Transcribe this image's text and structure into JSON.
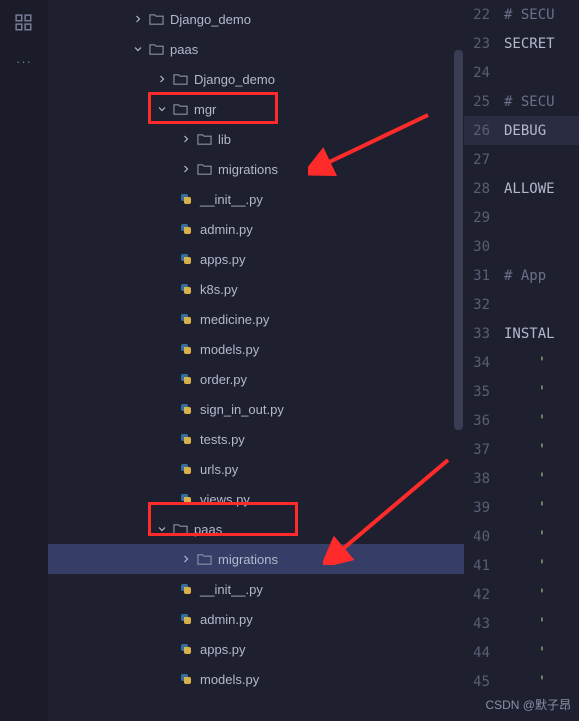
{
  "tree": [
    {
      "depth": 3,
      "type": "folder",
      "state": "collapsed",
      "label": "Django_demo"
    },
    {
      "depth": 3,
      "type": "folder",
      "state": "expanded",
      "label": "paas"
    },
    {
      "depth": 4,
      "type": "folder",
      "state": "collapsed",
      "label": "Django_demo"
    },
    {
      "depth": 4,
      "type": "folder",
      "state": "expanded",
      "label": "mgr"
    },
    {
      "depth": 5,
      "type": "folder",
      "state": "collapsed",
      "label": "lib"
    },
    {
      "depth": 5,
      "type": "folder",
      "state": "collapsed",
      "label": "migrations"
    },
    {
      "depth": 5,
      "type": "py",
      "label": "__init__.py"
    },
    {
      "depth": 5,
      "type": "py",
      "label": "admin.py"
    },
    {
      "depth": 5,
      "type": "py",
      "label": "apps.py"
    },
    {
      "depth": 5,
      "type": "py",
      "label": "k8s.py"
    },
    {
      "depth": 5,
      "type": "py",
      "label": "medicine.py"
    },
    {
      "depth": 5,
      "type": "py",
      "label": "models.py"
    },
    {
      "depth": 5,
      "type": "py",
      "label": "order.py"
    },
    {
      "depth": 5,
      "type": "py",
      "label": "sign_in_out.py"
    },
    {
      "depth": 5,
      "type": "py",
      "label": "tests.py"
    },
    {
      "depth": 5,
      "type": "py",
      "label": "urls.py"
    },
    {
      "depth": 5,
      "type": "py",
      "label": "views.py"
    },
    {
      "depth": 4,
      "type": "folder",
      "state": "expanded",
      "label": "paas"
    },
    {
      "depth": 5,
      "type": "folder",
      "state": "collapsed",
      "label": "migrations",
      "selected": true
    },
    {
      "depth": 5,
      "type": "py",
      "label": "__init__.py"
    },
    {
      "depth": 5,
      "type": "py",
      "label": "admin.py"
    },
    {
      "depth": 5,
      "type": "py",
      "label": "apps.py"
    },
    {
      "depth": 5,
      "type": "py",
      "label": "models.py"
    }
  ],
  "editor": [
    {
      "n": 22,
      "text": "# SECU",
      "cls": "comment"
    },
    {
      "n": 23,
      "text": "SECRET",
      "cls": "kw"
    },
    {
      "n": 24,
      "text": "",
      "cls": ""
    },
    {
      "n": 25,
      "text": "# SECU",
      "cls": "comment"
    },
    {
      "n": 26,
      "text": "DEBUG ",
      "cls": "kw",
      "current": true
    },
    {
      "n": 27,
      "text": "",
      "cls": ""
    },
    {
      "n": 28,
      "text": "ALLOWE",
      "cls": "kw"
    },
    {
      "n": 29,
      "text": "",
      "cls": ""
    },
    {
      "n": 30,
      "text": "",
      "cls": ""
    },
    {
      "n": 31,
      "text": "# App",
      "cls": "comment"
    },
    {
      "n": 32,
      "text": "",
      "cls": ""
    },
    {
      "n": 33,
      "text": "INSTAL",
      "cls": "kw"
    },
    {
      "n": 34,
      "text": "    '",
      "cls": "str"
    },
    {
      "n": 35,
      "text": "    '",
      "cls": "str"
    },
    {
      "n": 36,
      "text": "    '",
      "cls": "str"
    },
    {
      "n": 37,
      "text": "    '",
      "cls": "str"
    },
    {
      "n": 38,
      "text": "    '",
      "cls": "str"
    },
    {
      "n": 39,
      "text": "    '",
      "cls": "str"
    },
    {
      "n": 40,
      "text": "    '",
      "cls": "str"
    },
    {
      "n": 41,
      "text": "    '",
      "cls": "str"
    },
    {
      "n": 42,
      "text": "    '",
      "cls": "str"
    },
    {
      "n": 43,
      "text": "    '",
      "cls": "str"
    },
    {
      "n": 44,
      "text": "    '",
      "cls": "str"
    },
    {
      "n": 45,
      "text": "    '",
      "cls": "str"
    }
  ],
  "watermark": "CSDN @默子昂"
}
